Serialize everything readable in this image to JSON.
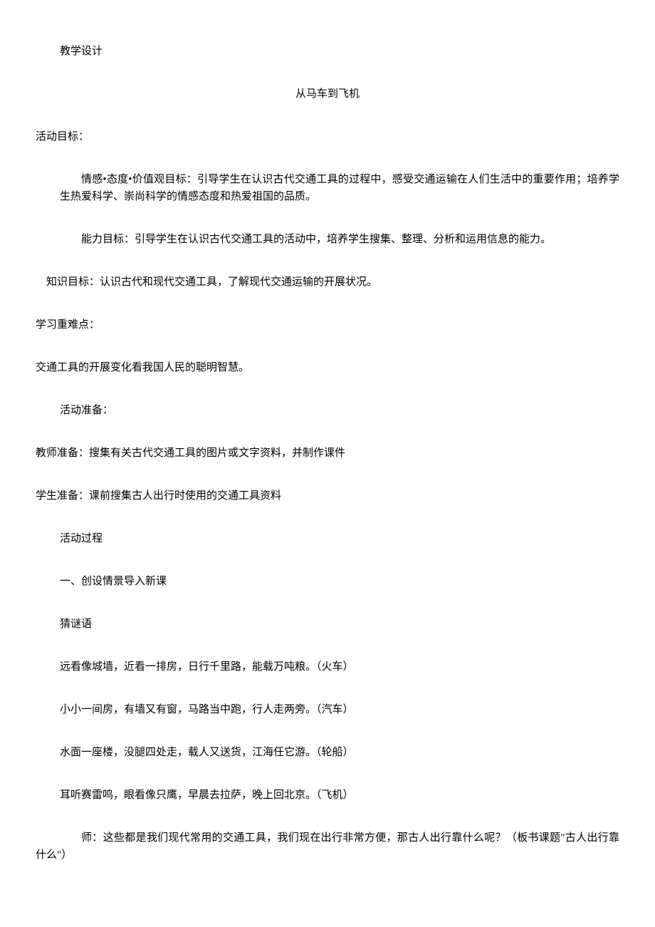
{
  "header": {
    "design_label": "教学设计"
  },
  "title": "从马车到飞机",
  "objectives": {
    "heading": "活动目标：",
    "emotion": "情感•态度•价值观目标：引导学生在认识古代交通工具的过程中，感受交通运输在人们生活中的重要作用；培养学生热爱科学、崇尚科学的情感态度和热爱祖国的品质。",
    "ability": "能力目标：引导学生在认识古代交通工具的活动中，培养学生搜集、整理、分析和运用信息的能力。",
    "knowledge": "知识目标：认识古代和现代交通工具，了解现代交通运输的开展状况。"
  },
  "difficulty": {
    "heading": "学习重难点：",
    "content": "交通工具的开展变化看我国人民的聪明智慧。"
  },
  "preparation": {
    "heading": "活动准备：",
    "teacher": "教师准备：搜集有关古代交通工具的图片或文字资料，并制作课件",
    "student": "学生准备：课前搜集古人出行时使用的交通工具资料"
  },
  "process": {
    "heading": "活动过程",
    "section1_title": "一、创设情景导入新课",
    "riddle_label": "猜谜语",
    "riddle1": "远看像城墙，近看一排房，日行千里路，能载万吨粮。（火车）",
    "riddle2": "小小一间房，有墙又有窗，马路当中跑，行人走两旁。（汽车）",
    "riddle3": "水面一座楼，没腿四处走，载人又送货，江海任它游。（轮船）",
    "riddle4": "耳听赛雷鸣，眼看像只鹰，早晨去拉萨，晚上回北京。（飞机）",
    "teacher_line": "师：这些都是我们现代常用的交通工具，我们现在出行非常方便，那古人出行靠什么呢？（板书课题\"古人出行靠什么\"）"
  }
}
